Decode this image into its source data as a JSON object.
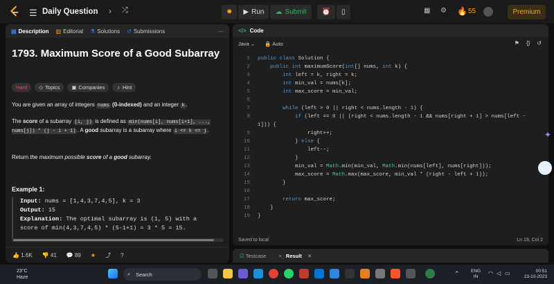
{
  "top": {
    "title": "Daily Question",
    "run_label": "Run",
    "submit_label": "Submit",
    "streak": "55",
    "premium_label": "Premium"
  },
  "left_tabs": [
    {
      "label": "Description"
    },
    {
      "label": "Editorial"
    },
    {
      "label": "Solutions"
    },
    {
      "label": "Submissions"
    }
  ],
  "problem": {
    "title": "1793. Maximum Score of a Good Subarray",
    "difficulty": "Hard",
    "tags": [
      "Topics",
      "Companies",
      "Hint"
    ],
    "p1_a": "You are given an array of integers ",
    "p1_code1": "nums",
    "p1_b": " (0-indexed)",
    "p1_c": " and an integer ",
    "p1_code2": "k",
    "p1_d": ".",
    "p2_a": "The ",
    "p2_b": "score",
    "p2_c": " of a subarray ",
    "p2_code1": "(i, j)",
    "p2_d": " is defined as ",
    "p2_code2": "min(nums[i], nums[i+1], ..., nums[j]) * (j - i + 1)",
    "p2_e": ". A ",
    "p2_f": "good",
    "p2_g": " subarray is a subarray where ",
    "p2_code3": "i <= k <= j",
    "p2_h": ".",
    "p3_a": "Return ",
    "p3_b": "the maximum possible ",
    "p3_c": "score",
    "p3_d": " of a ",
    "p3_e": "good",
    "p3_f": " subarray.",
    "example_title": "Example 1:",
    "ex_input_label": "Input:",
    "ex_input": " nums = [1,4,3,7,4,5], k = 3",
    "ex_output_label": "Output:",
    "ex_output": " 15",
    "ex_expl_label": "Explanation:",
    "ex_expl": " The optimal subarray is (1, 5) with a",
    "ex_expl2": "score of min(4,3,7,4,5) * (5-1+1) = 3 * 5 = 15."
  },
  "stats": {
    "likes": "1.6K",
    "dislikes": "41",
    "comments": "89"
  },
  "code_panel": {
    "tab": "Code",
    "language": "Java",
    "mode": "Auto",
    "footer_left": "Saved to local",
    "footer_right": "Ln 19, Col 2",
    "lines": [
      {
        "n": "1",
        "t": "public class Solution {"
      },
      {
        "n": "2",
        "t": "    public int maximumScore(int[] nums, int k) {"
      },
      {
        "n": "3",
        "t": "        int left = k, right = k;"
      },
      {
        "n": "4",
        "t": "        int min_val = nums[k];"
      },
      {
        "n": "5",
        "t": "        int max_score = min_val;"
      },
      {
        "n": "6",
        "t": ""
      },
      {
        "n": "7",
        "t": "        while (left > 0 || right < nums.length - 1) {"
      },
      {
        "n": "8",
        "t": "            if (left == 0 || (right < nums.length - 1 && nums[right + 1] > nums[left -"
      },
      {
        "n": "",
        "t": "1])) {"
      },
      {
        "n": "9",
        "t": "                right++;"
      },
      {
        "n": "10",
        "t": "            } else {"
      },
      {
        "n": "11",
        "t": "                left--;"
      },
      {
        "n": "12",
        "t": "            }"
      },
      {
        "n": "13",
        "t": "            min_val = Math.min(min_val, Math.min(nums[left], nums[right]));"
      },
      {
        "n": "14",
        "t": "            max_score = Math.max(max_score, min_val * (right - left + 1));"
      },
      {
        "n": "15",
        "t": "        }"
      },
      {
        "n": "16",
        "t": ""
      },
      {
        "n": "17",
        "t": "        return max_score;"
      },
      {
        "n": "18",
        "t": "    }"
      },
      {
        "n": "19",
        "t": "}"
      }
    ]
  },
  "result_bar": {
    "testcase": "Testcase",
    "result": "Result"
  },
  "taskbar": {
    "temp": "23°C",
    "weather": "Haze",
    "search": "Search",
    "lang1": "ENG",
    "lang2": "IN",
    "time": "00:51",
    "date": "23-10-2023"
  },
  "colors": {
    "accent": "#ffa116",
    "hard": "#ef4743",
    "submit": "#2cbb5d"
  }
}
